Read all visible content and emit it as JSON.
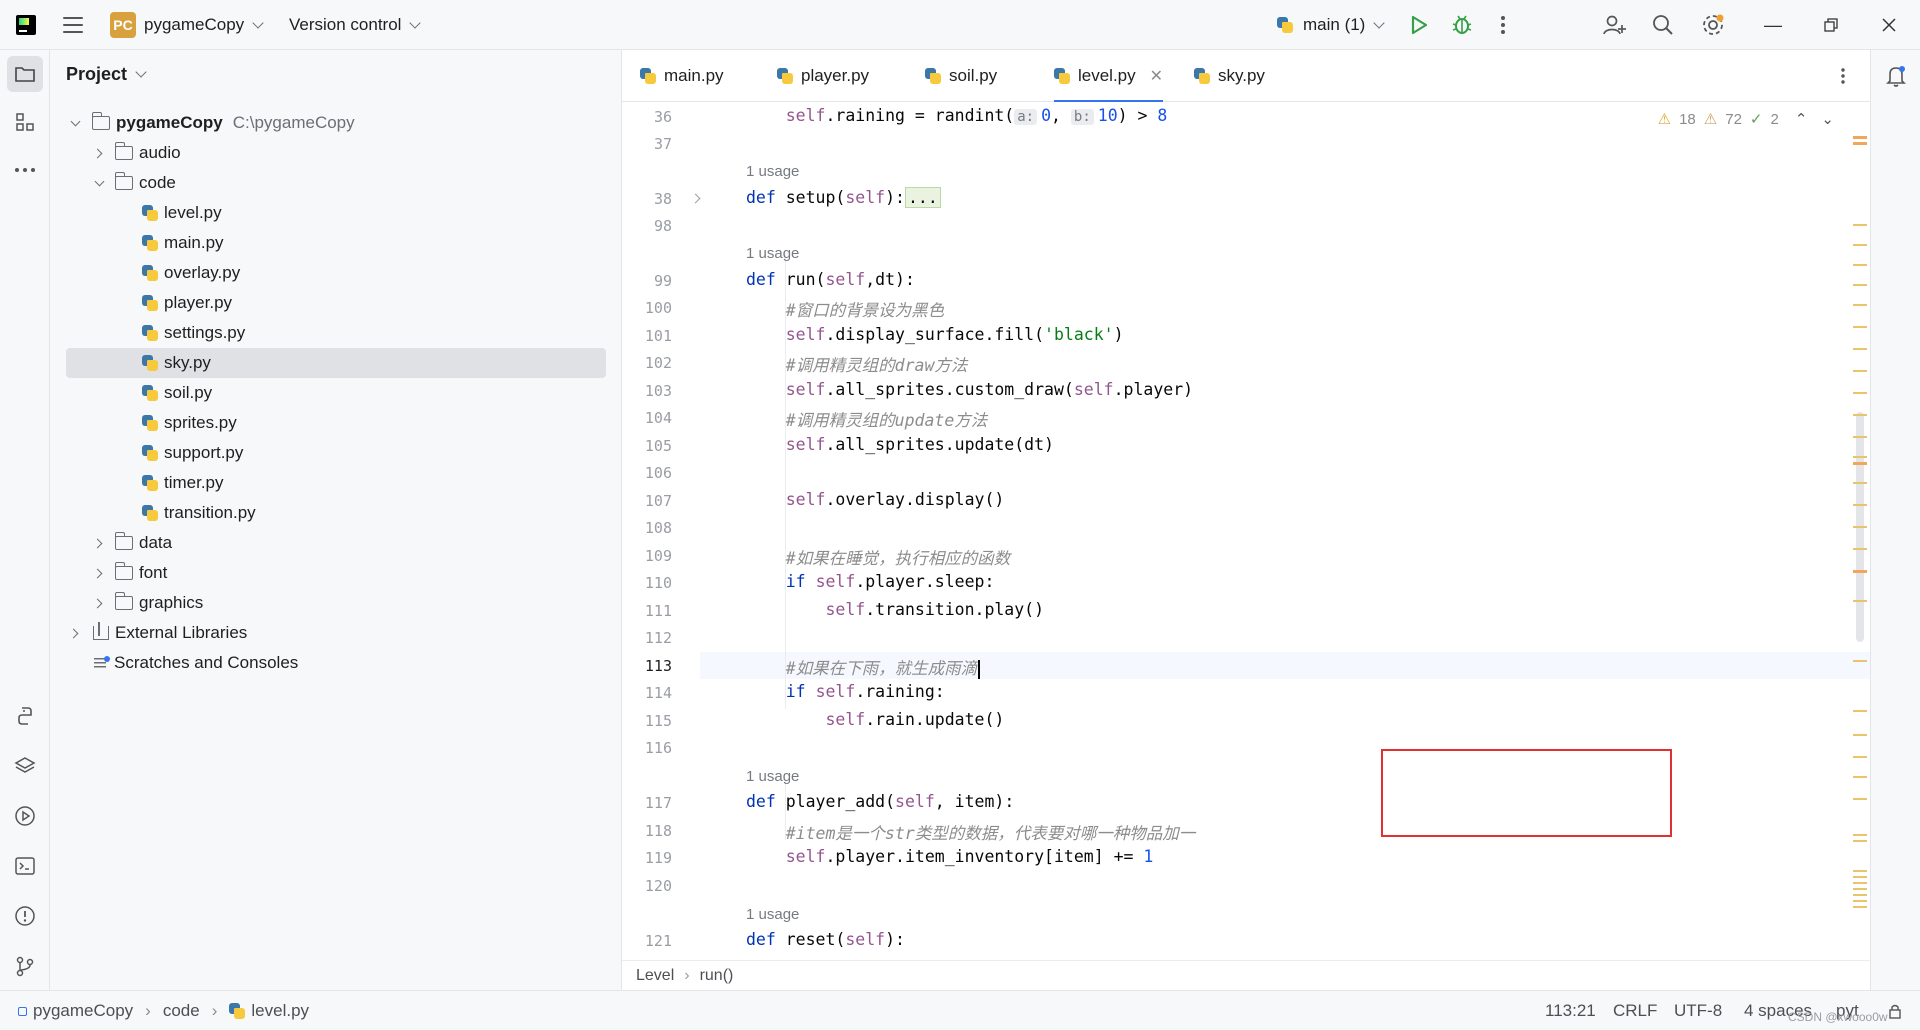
{
  "titlebar": {
    "project_badge": "PC",
    "project_name": "pygameCopy",
    "vcs_label": "Version control",
    "run_config": "main (1)"
  },
  "project_panel": {
    "title": "Project",
    "root_name": "pygameCopy",
    "root_path": "C:\\pygameCopy",
    "items": [
      {
        "label": "audio"
      },
      {
        "label": "code"
      },
      {
        "label": "level.py"
      },
      {
        "label": "main.py"
      },
      {
        "label": "overlay.py"
      },
      {
        "label": "player.py"
      },
      {
        "label": "settings.py"
      },
      {
        "label": "sky.py"
      },
      {
        "label": "soil.py"
      },
      {
        "label": "sprites.py"
      },
      {
        "label": "support.py"
      },
      {
        "label": "timer.py"
      },
      {
        "label": "transition.py"
      },
      {
        "label": "data"
      },
      {
        "label": "font"
      },
      {
        "label": "graphics"
      },
      {
        "label": "External Libraries"
      },
      {
        "label": "Scratches and Consoles"
      }
    ]
  },
  "tabs": [
    {
      "label": "main.py"
    },
    {
      "label": "player.py"
    },
    {
      "label": "soil.py"
    },
    {
      "label": "level.py"
    },
    {
      "label": "sky.py"
    }
  ],
  "inspections": {
    "warnings": "18",
    "weak_warnings": "72",
    "ok": "2"
  },
  "editor": {
    "line_numbers": [
      "36",
      "37",
      "38",
      "98",
      "99",
      "100",
      "101",
      "102",
      "103",
      "104",
      "105",
      "106",
      "107",
      "108",
      "109",
      "110",
      "111",
      "112",
      "113",
      "114",
      "115",
      "116",
      "117",
      "118",
      "119",
      "120",
      "121"
    ],
    "usage_hint": "1 usage",
    "code": {
      "l36_self": "self",
      "l36_mid": ".raining = randint(",
      "l36_hint_a": "a:",
      "l36_v0": "0",
      "l36_comma": ", ",
      "l36_hint_b": "b:",
      "l36_v10": "10",
      "l36_end": ") > ",
      "l36_v8": "8",
      "def": "def",
      "l38_name": " setup(",
      "l38_self": "self",
      "l38_close": "):",
      "l38_fold": "...",
      "l99_name": " run(",
      "l99_self": "self",
      "l99_rest": ",dt):",
      "l100": "#窗口的背景设为黑色",
      "l101_self": "self",
      "l101_a": ".display_surface.fill(",
      "l101_str": "'black'",
      "l101_b": ")",
      "l102": "#调用精灵组的draw方法",
      "l103_self": "self",
      "l103_a": ".all_sprites.custom_draw(",
      "l103_self2": "self",
      "l103_b": ".player)",
      "l104": "#调用精灵组的update方法",
      "l105_self": "self",
      "l105_a": ".all_sprites.update(dt)",
      "l107_self": "self",
      "l107_a": ".overlay.display()",
      "l109": "#如果在睡觉，执行相应的函数",
      "if": "if",
      "l110_self": "self",
      "l110_a": ".player.sleep:",
      "l111_self": "self",
      "l111_a": ".transition.play()",
      "l113": "#如果在下雨，就生成雨滴",
      "l114_self": "self",
      "l114_a": ".raining:",
      "l115_self": "self",
      "l115_a": ".rain.update()",
      "l117_name": " player_add(",
      "l117_self": "self",
      "l117_rest": ", item):",
      "l118": "#item是一个str类型的数据，代表要对哪一种物品加一",
      "l119_self": "self",
      "l119_a": ".player.item_inventory[item] += ",
      "l119_v1": "1",
      "l121_name": " reset(",
      "l121_self": "self",
      "l121_close": "):"
    }
  },
  "breadcrumb_bar": {
    "class_name": "Level",
    "method_name": "run()"
  },
  "statusbar": {
    "project": "pygameCopy",
    "folder": "code",
    "file": "level.py",
    "position": "113:21",
    "line_sep": "CRLF",
    "encoding": "UTF-8",
    "indent": "4 spaces",
    "lang": "pyt",
    "watermark": "CSDN @xwooo0w"
  },
  "colors": {
    "accent": "#3574f0",
    "keyword": "#0033b3",
    "self": "#94558d",
    "string": "#067d17",
    "number": "#1750eb",
    "comment": "#8c8c8c",
    "highlight_box": "#e03030"
  }
}
